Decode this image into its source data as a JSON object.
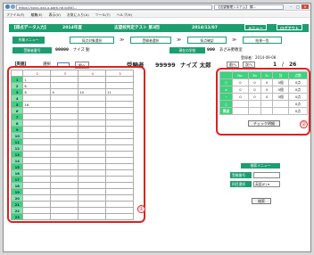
{
  "browser": {
    "address": "https://xxxx-xxx-x-park.ne.jp/NO...",
    "tab_title": "【志望管理システム】 模..."
  },
  "menu": [
    "ファイル(F)",
    "編集(E)",
    "表示(V)",
    "お気に入り(A)",
    "ツール(T)",
    "ヘルプ(H)"
  ],
  "header": {
    "title": "【得点データ入力】",
    "year": "2014年度",
    "exam": "志望校判定テスト 第3回",
    "date": "2014/11/07",
    "menu_btn": "メニュー",
    "logout_btn": "ログアウト"
  },
  "crumbs": [
    "作業メニュー",
    "採点対象選択",
    "受験者選択",
    "採点確認",
    "結果一覧"
  ],
  "row3": {
    "btn": "受験者番号",
    "number": "99999",
    "name": "ナイズ 勤",
    "pill2": "現在の学校",
    "code": "999",
    "school": "あざみ野教室"
  },
  "registered": "登録者：2014-09-08",
  "subject": {
    "label": "【英語】",
    "mode_label": "選択",
    "back_btn": "前へ",
    "examinee_label": "受験者",
    "number": "99999",
    "name": "ナイズ 太郎"
  },
  "nav": {
    "prev": "前へ",
    "next": "次へ",
    "page": "1",
    "sep": "/",
    "total": "26"
  },
  "grid": {
    "header": [
      "",
      "2",
      "3",
      "4",
      "5"
    ],
    "rows": [
      [
        "1",
        "1",
        "",
        "",
        ""
      ],
      [
        "2",
        "6",
        "",
        "",
        ""
      ],
      [
        "3",
        "8",
        "9",
        "10",
        "11"
      ],
      [
        "4",
        "",
        "",
        "",
        ""
      ],
      [
        "5",
        "16",
        "",
        "",
        ""
      ],
      [
        "6",
        "",
        "",
        "",
        ""
      ],
      [
        "7",
        "",
        "",
        "",
        ""
      ],
      [
        "8",
        "",
        "",
        "",
        ""
      ],
      [
        "9",
        "",
        "",
        "",
        ""
      ],
      [
        "10",
        "",
        "",
        "",
        ""
      ],
      [
        "11",
        "",
        "",
        "",
        ""
      ],
      [
        "12",
        "",
        "",
        "",
        ""
      ],
      [
        "13",
        "",
        "",
        "",
        ""
      ],
      [
        "14",
        "",
        "",
        "",
        ""
      ],
      [
        "15",
        "",
        "",
        "",
        ""
      ],
      [
        "16",
        "",
        "",
        "",
        ""
      ],
      [
        "17",
        "",
        "",
        "",
        ""
      ],
      [
        "18",
        "",
        "",
        "",
        ""
      ],
      [
        "19",
        "",
        "",
        "",
        ""
      ],
      [
        "20",
        "",
        "",
        "",
        ""
      ],
      [
        "21",
        "",
        "",
        "",
        ""
      ],
      [
        "22",
        "",
        "",
        "",
        ""
      ],
      [
        "23",
        "",
        "",
        "",
        ""
      ]
    ]
  },
  "summary": {
    "header": [
      "",
      "No.",
      "3b",
      "3c",
      "計",
      "点数"
    ],
    "rows": [
      [
        "○",
        "0",
        "0",
        "0",
        "0個",
        "0点"
      ],
      [
        "×",
        "0",
        "0",
        "0",
        "0個",
        "0点"
      ],
      [
        "-",
        "0",
        "0",
        "0",
        "0個",
        "0点"
      ],
      [
        "△",
        "",
        "",
        "",
        "",
        "0点"
      ],
      [
        "得点",
        "",
        "",
        "",
        "",
        "0点"
      ]
    ],
    "check_btn": "チェック明細"
  },
  "panel": {
    "title": "検索メニュー",
    "label1": "受験番号",
    "label2": "科目選択",
    "value2": "英語(E) ▾",
    "search_btn": "検索"
  },
  "markers": [
    "①",
    "②"
  ]
}
